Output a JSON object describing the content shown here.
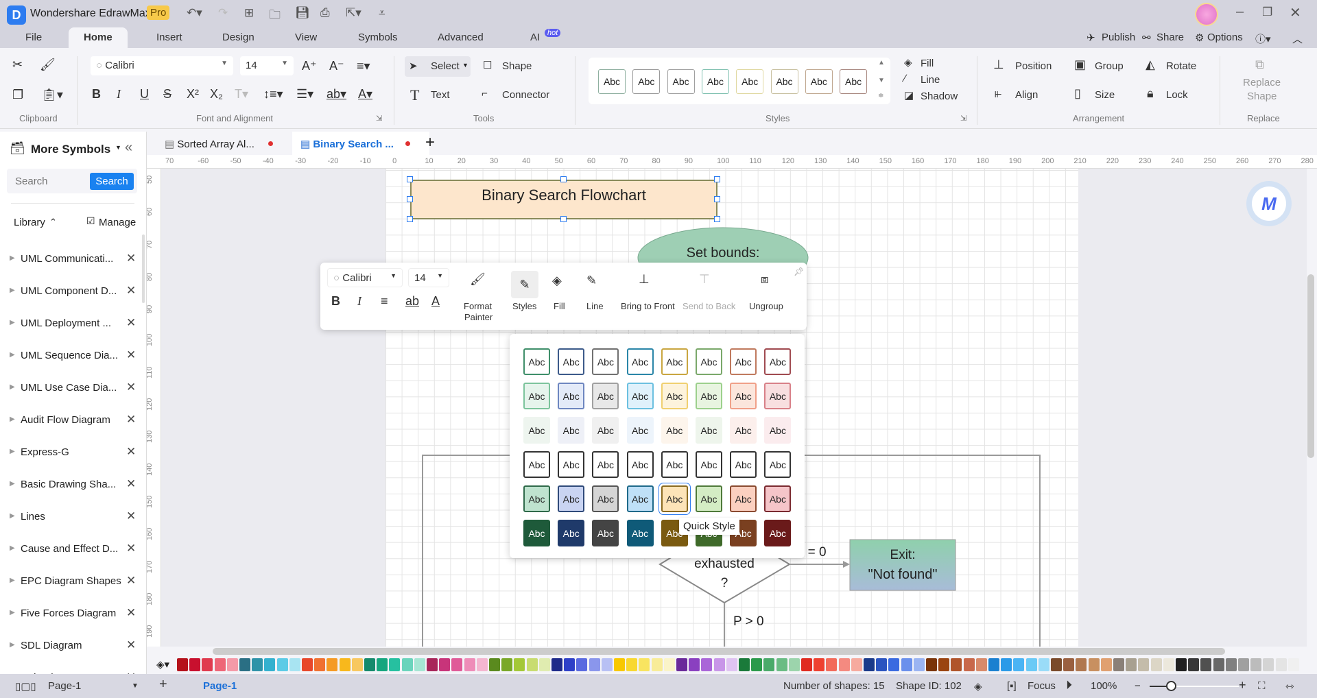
{
  "app": {
    "title": "Wondershare EdrawMax",
    "badge": "Pro"
  },
  "menu": {
    "tabs": [
      "File",
      "Home",
      "Insert",
      "Design",
      "View",
      "Symbols",
      "Advanced",
      "AI"
    ],
    "hot_badge": "hot",
    "active": "Home"
  },
  "topright": {
    "publish": "Publish",
    "share": "Share",
    "options": "Options"
  },
  "ribbon": {
    "font": {
      "name": "Calibri",
      "size": "14"
    },
    "tools": {
      "select": "Select",
      "shape": "Shape",
      "text": "Text",
      "connector": "Connector"
    },
    "styles": {
      "gallery": [
        "Abc",
        "Abc",
        "Abc",
        "Abc",
        "Abc",
        "Abc",
        "Abc",
        "Abc"
      ],
      "gallery_borders": [
        "#8fb0a0",
        "#9a9a9a",
        "#a0a0a0",
        "#7fc0b0",
        "#e0d8a0",
        "#c8c0a0",
        "#c0a890",
        "#a88880"
      ],
      "fill": "Fill",
      "line": "Line",
      "shadow": "Shadow"
    },
    "arrangement": {
      "position": "Position",
      "group": "Group",
      "rotate": "Rotate",
      "align": "Align",
      "size": "Size",
      "lock": "Lock"
    },
    "replace": {
      "label1": "Replace",
      "label2": "Shape"
    },
    "groups": {
      "clipboard": "Clipboard",
      "font": "Font and Alignment",
      "tools": "Tools",
      "styles": "Styles",
      "arrangement": "Arrangement",
      "replace": "Replace"
    }
  },
  "doc_tabs": [
    {
      "label": "Sorted Array Al...",
      "active": false
    },
    {
      "label": "Binary Search ...",
      "active": true
    }
  ],
  "sidebar": {
    "title": "More Symbols",
    "search_placeholder": "Search",
    "search_button": "Search",
    "library": "Library",
    "manage": "Manage",
    "items": [
      "UML Communicati...",
      "UML Component D...",
      "UML Deployment ...",
      "UML Sequence Dia...",
      "UML Use Case Dia...",
      "Audit Flow Diagram",
      "Express-G",
      "Basic Drawing Sha...",
      "Lines",
      "Cause and Effect D...",
      "EPC Diagram Shapes",
      "Five Forces Diagram",
      "SDL Diagram",
      "Calendar"
    ]
  },
  "rulers": {
    "top": [
      "70",
      "-60",
      "-50",
      "-40",
      "-30",
      "-20",
      "-10",
      "0",
      "10",
      "20",
      "30",
      "40",
      "50",
      "60",
      "70",
      "80",
      "90",
      "100",
      "110",
      "120",
      "130",
      "140",
      "150",
      "160",
      "170",
      "180",
      "190",
      "200",
      "210",
      "220",
      "230",
      "240",
      "250",
      "260",
      "270",
      "280"
    ],
    "left": [
      "50",
      "60",
      "70",
      "80",
      "90",
      "100",
      "110",
      "120",
      "130",
      "140",
      "150",
      "160",
      "170",
      "180",
      "190"
    ]
  },
  "diagram": {
    "title": "Binary Search Flowchart",
    "start": "Set bounds:",
    "decision_line1": "exhausted",
    "decision_line2": "?",
    "label_eq": "P = 0",
    "label_gt": "P > 0",
    "exit_line1": "Exit:",
    "exit_line2": "\"Not found\""
  },
  "floatbar": {
    "font": "Calibri",
    "size": "14",
    "format_painter_1": "Format",
    "format_painter_2": "Painter",
    "styles": "Styles",
    "fill": "Fill",
    "line": "Line",
    "bring_front": "Bring to Front",
    "send_back": "Send to Back",
    "ungroup": "Ungroup"
  },
  "quick_styles": {
    "label": "Abc",
    "tooltip": "Quick Style",
    "selected": "row 5, column 5",
    "rows": [
      {
        "fills": [
          "#ffffff",
          "#ffffff",
          "#ffffff",
          "#ffffff",
          "#ffffff",
          "#ffffff",
          "#ffffff",
          "#ffffff"
        ],
        "borders": [
          "#3f8f6a",
          "#3c5a8a",
          "#707070",
          "#2a86a8",
          "#c9a640",
          "#7aa86a",
          "#c07a5e",
          "#a04a50"
        ],
        "text": "#222222"
      },
      {
        "fills": [
          "#e6f4ec",
          "#e3eaf8",
          "#e8e8e8",
          "#e0f1fb",
          "#fdf3dc",
          "#e8f4e0",
          "#fbe6dc",
          "#f8dfe0"
        ],
        "borders": [
          "#7cc49c",
          "#6d86c0",
          "#a0a0a0",
          "#6cc0e0",
          "#f0d070",
          "#9cd08c",
          "#f0a088",
          "#d88088"
        ],
        "text": "#222222"
      },
      {
        "fills": [
          "#eef5ef",
          "#eef0f7",
          "#f0f0f0",
          "#edf4fb",
          "#fdf5ec",
          "#eef5ec",
          "#fcefec",
          "#fbecee"
        ],
        "borders": [
          "#eef5ef",
          "#eef0f7",
          "#f0f0f0",
          "#edf4fb",
          "#fdf5ec",
          "#eef5ec",
          "#fcefec",
          "#fbecee"
        ],
        "text": "#222222"
      },
      {
        "fills": [
          "#ffffff",
          "#ffffff",
          "#ffffff",
          "#ffffff",
          "#ffffff",
          "#ffffff",
          "#ffffff",
          "#ffffff"
        ],
        "borders": [
          "#333333",
          "#333333",
          "#333333",
          "#333333",
          "#333333",
          "#333333",
          "#333333",
          "#333333"
        ],
        "text": "#222222"
      },
      {
        "fills": [
          "#bfe3cf",
          "#c9d4f2",
          "#d5d5d5",
          "#bfe0f7",
          "#fde4b8",
          "#d4ecc4",
          "#fbd0c0",
          "#f5c5c9"
        ],
        "borders": [
          "#2f6a4a",
          "#2f4a7a",
          "#555555",
          "#1f6a8a",
          "#8a6a20",
          "#4f7a3a",
          "#8a4a30",
          "#7a2a30"
        ],
        "text": "#222222"
      },
      {
        "fills": [
          "#1e5a3a",
          "#1f3a6a",
          "#444444",
          "#0f5a78",
          "#7a5a10",
          "#3f6a2a",
          "#7a4020",
          "#6a1a1a"
        ],
        "borders": [
          "#1e5a3a",
          "#1f3a6a",
          "#444444",
          "#0f5a78",
          "#7a5a10",
          "#3f6a2a",
          "#7a4020",
          "#6a1a1a"
        ],
        "text": "#ffffff"
      }
    ]
  },
  "palette": [
    "#b5121b",
    "#c8102e",
    "#e03a4e",
    "#ee6677",
    "#f49aa8",
    "#2a6f84",
    "#2e93a8",
    "#34b1cf",
    "#5ccbe6",
    "#a8e4f2",
    "#e8472a",
    "#f07030",
    "#f59a24",
    "#f8b81c",
    "#f8c860",
    "#158a6c",
    "#16a67e",
    "#26c0a0",
    "#6ad4bc",
    "#a6e6d4",
    "#a8265a",
    "#c8347a",
    "#e05a98",
    "#ee8cb8",
    "#f4b6d0",
    "#5a8a1e",
    "#7aa828",
    "#a4c838",
    "#c8dc70",
    "#e0ecb0",
    "#1e2a8a",
    "#2e40c8",
    "#5a6ae0",
    "#8a96ec",
    "#b8c0f4",
    "#f8c800",
    "#f8d830",
    "#f8e460",
    "#f8ec98",
    "#faf4c8",
    "#6a2a9a",
    "#8a40c0",
    "#aa66d8",
    "#c896e8",
    "#e0c4f2",
    "#1a7a3a",
    "#2a9a4a",
    "#4aaa6a",
    "#6abc84",
    "#9cd4ac",
    "#e02a20",
    "#ee4030",
    "#f26a5a",
    "#f48a80",
    "#f6aa9e",
    "#1a3a8a",
    "#2a54c0",
    "#3a6ae0",
    "#6a90ec",
    "#9ab4f2",
    "#7a3408",
    "#9a4410",
    "#b0542a",
    "#c8684a",
    "#d88a6a",
    "#1a80d0",
    "#2a9ae8",
    "#4ab4f4",
    "#6acaf6",
    "#9adcf8",
    "#7a4a2a",
    "#9a6040",
    "#b07850",
    "#c89060",
    "#e0a070",
    "#8a8078",
    "#a8a090",
    "#c4bcaa",
    "#dcd6c6",
    "#ece8dc",
    "#202020",
    "#383838",
    "#505050",
    "#686868",
    "#808080",
    "#a0a0a0",
    "#bcbcbc",
    "#d4d4d4",
    "#e4e4e4",
    "#f0f0f0"
  ],
  "status": {
    "page_selector": "Page-1",
    "page_tab": "Page-1",
    "shapes": "Number of shapes: 15",
    "shape_id": "Shape ID: 102",
    "focus": "Focus",
    "zoom": "100%",
    "zoom_level_percent": 100
  }
}
